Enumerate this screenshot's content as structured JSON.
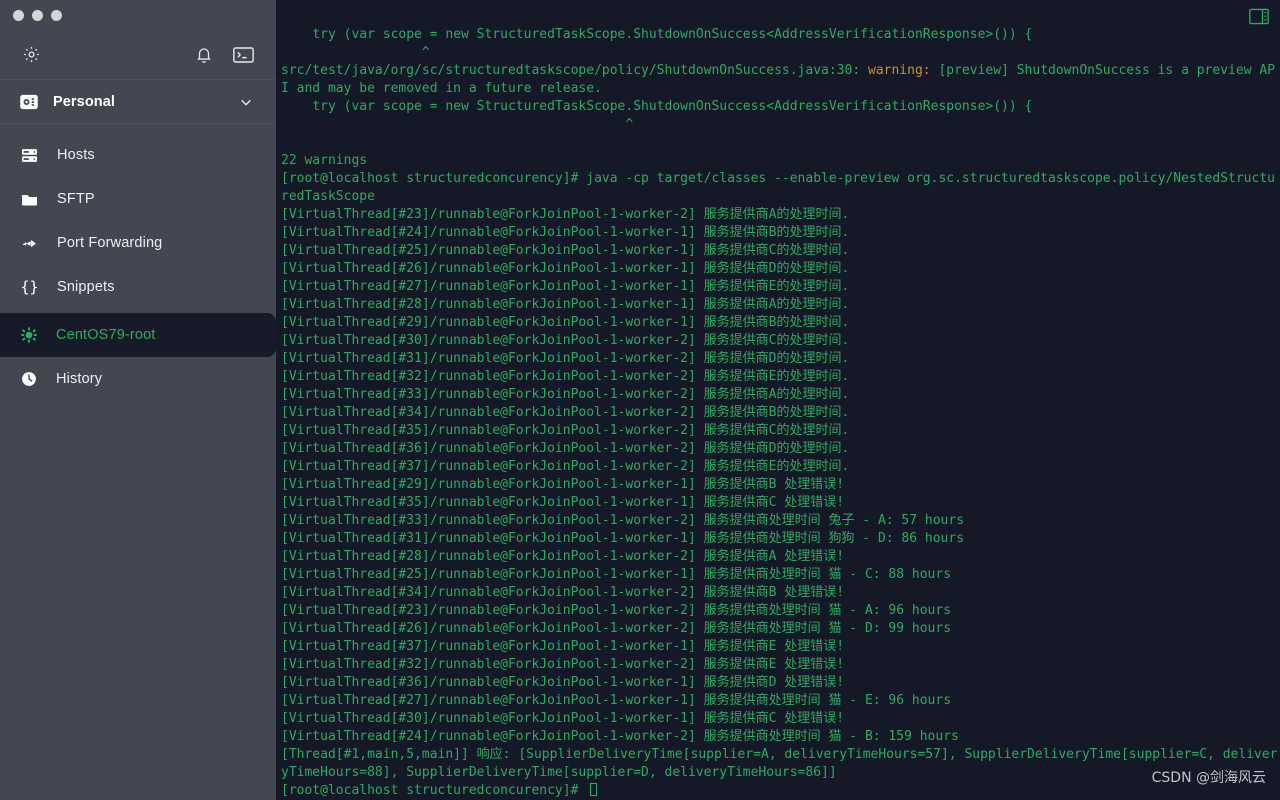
{
  "window": {
    "traffic_lights": [
      "close",
      "minimize",
      "maximize"
    ]
  },
  "sidebar": {
    "toolbar": {
      "settings_icon": "gear-icon",
      "notifications_icon": "bell-icon",
      "terminal_icon": "terminal-icon"
    },
    "vault": {
      "icon": "vault-icon",
      "label": "Personal",
      "chevron": "chevron-down-icon"
    },
    "items": [
      {
        "icon": "server-icon",
        "label": "Hosts",
        "selected": false
      },
      {
        "icon": "folder-icon",
        "label": "SFTP",
        "selected": false
      },
      {
        "icon": "port-forwarding-icon",
        "label": "Port Forwarding",
        "selected": false
      },
      {
        "icon": "braces-icon",
        "label": "Snippets",
        "selected": false
      },
      {
        "icon": "centos-icon",
        "label": "CentOS79-root",
        "selected": true
      },
      {
        "icon": "clock-icon",
        "label": "History",
        "selected": false
      }
    ]
  },
  "terminal": {
    "panel_toggle_icon": "split-panel-icon",
    "colors": {
      "background": "#141827",
      "foreground": "#2eab62",
      "warning": "#c8922b"
    },
    "prompt": "[root@localhost structuredconcurency]#",
    "cursor": "block",
    "lines": [
      {
        "text": "    try (var scope = new StructuredTaskScope.ShutdownOnSuccess<AddressVerificationResponse>()) {"
      },
      {
        "text": "                  ^"
      },
      {
        "segments": [
          {
            "text": "src/test/java/org/sc/structuredtaskscope/policy/ShutdownOnSuccess.java:30: "
          },
          {
            "text": "warning:",
            "cls": "warn"
          },
          {
            "text": " [preview] ShutdownOnSuccess is a preview API and may be removed in a future release."
          }
        ]
      },
      {
        "text": "    try (var scope = new StructuredTaskScope.ShutdownOnSuccess<AddressVerificationResponse>()) {"
      },
      {
        "text": "                                            ^"
      },
      {
        "text": ""
      },
      {
        "text": "22 warnings"
      },
      {
        "text": "[root@localhost structuredconcurency]# java -cp target/classes --enable-preview org.sc.structuredtaskscope.policy/NestedStructuredTaskScope"
      },
      {
        "text": "[VirtualThread[#23]/runnable@ForkJoinPool-1-worker-2] 服务提供商A的处理时间."
      },
      {
        "text": "[VirtualThread[#24]/runnable@ForkJoinPool-1-worker-1] 服务提供商B的处理时间."
      },
      {
        "text": "[VirtualThread[#25]/runnable@ForkJoinPool-1-worker-1] 服务提供商C的处理时间."
      },
      {
        "text": "[VirtualThread[#26]/runnable@ForkJoinPool-1-worker-1] 服务提供商D的处理时间."
      },
      {
        "text": "[VirtualThread[#27]/runnable@ForkJoinPool-1-worker-1] 服务提供商E的处理时间."
      },
      {
        "text": "[VirtualThread[#28]/runnable@ForkJoinPool-1-worker-1] 服务提供商A的处理时间."
      },
      {
        "text": "[VirtualThread[#29]/runnable@ForkJoinPool-1-worker-1] 服务提供商B的处理时间."
      },
      {
        "text": "[VirtualThread[#30]/runnable@ForkJoinPool-1-worker-2] 服务提供商C的处理时间."
      },
      {
        "text": "[VirtualThread[#31]/runnable@ForkJoinPool-1-worker-2] 服务提供商D的处理时间."
      },
      {
        "text": "[VirtualThread[#32]/runnable@ForkJoinPool-1-worker-2] 服务提供商E的处理时间."
      },
      {
        "text": "[VirtualThread[#33]/runnable@ForkJoinPool-1-worker-2] 服务提供商A的处理时间."
      },
      {
        "text": "[VirtualThread[#34]/runnable@ForkJoinPool-1-worker-2] 服务提供商B的处理时间."
      },
      {
        "text": "[VirtualThread[#35]/runnable@ForkJoinPool-1-worker-2] 服务提供商C的处理时间."
      },
      {
        "text": "[VirtualThread[#36]/runnable@ForkJoinPool-1-worker-2] 服务提供商D的处理时间."
      },
      {
        "text": "[VirtualThread[#37]/runnable@ForkJoinPool-1-worker-2] 服务提供商E的处理时间."
      },
      {
        "text": "[VirtualThread[#29]/runnable@ForkJoinPool-1-worker-1] 服务提供商B 处理错误!"
      },
      {
        "text": "[VirtualThread[#35]/runnable@ForkJoinPool-1-worker-1] 服务提供商C 处理错误!"
      },
      {
        "text": "[VirtualThread[#33]/runnable@ForkJoinPool-1-worker-2] 服务提供商处理时间 兔子 - A: 57 hours"
      },
      {
        "text": "[VirtualThread[#31]/runnable@ForkJoinPool-1-worker-1] 服务提供商处理时间 狗狗 - D: 86 hours"
      },
      {
        "text": "[VirtualThread[#28]/runnable@ForkJoinPool-1-worker-2] 服务提供商A 处理错误!"
      },
      {
        "text": "[VirtualThread[#25]/runnable@ForkJoinPool-1-worker-1] 服务提供商处理时间 猫 - C: 88 hours"
      },
      {
        "text": "[VirtualThread[#34]/runnable@ForkJoinPool-1-worker-2] 服务提供商B 处理错误!"
      },
      {
        "text": "[VirtualThread[#23]/runnable@ForkJoinPool-1-worker-2] 服务提供商处理时间 猫 - A: 96 hours"
      },
      {
        "text": "[VirtualThread[#26]/runnable@ForkJoinPool-1-worker-2] 服务提供商处理时间 猫 - D: 99 hours"
      },
      {
        "text": "[VirtualThread[#37]/runnable@ForkJoinPool-1-worker-1] 服务提供商E 处理错误!"
      },
      {
        "text": "[VirtualThread[#32]/runnable@ForkJoinPool-1-worker-2] 服务提供商E 处理错误!"
      },
      {
        "text": "[VirtualThread[#36]/runnable@ForkJoinPool-1-worker-1] 服务提供商D 处理错误!"
      },
      {
        "text": "[VirtualThread[#27]/runnable@ForkJoinPool-1-worker-1] 服务提供商处理时间 猫 - E: 96 hours"
      },
      {
        "text": "[VirtualThread[#30]/runnable@ForkJoinPool-1-worker-1] 服务提供商C 处理错误!"
      },
      {
        "text": "[VirtualThread[#24]/runnable@ForkJoinPool-1-worker-2] 服务提供商处理时间 猫 - B: 159 hours"
      },
      {
        "text": "[Thread[#1,main,5,main]] 响应: [SupplierDeliveryTime[supplier=A, deliveryTimeHours=57], SupplierDeliveryTime[supplier=C, deliveryTimeHours=88], SupplierDeliveryTime[supplier=D, deliveryTimeHours=86]]"
      },
      {
        "text": "[root@localhost structuredconcurency]# ",
        "cursor": true
      }
    ]
  },
  "watermark": "CSDN @剑海风云"
}
